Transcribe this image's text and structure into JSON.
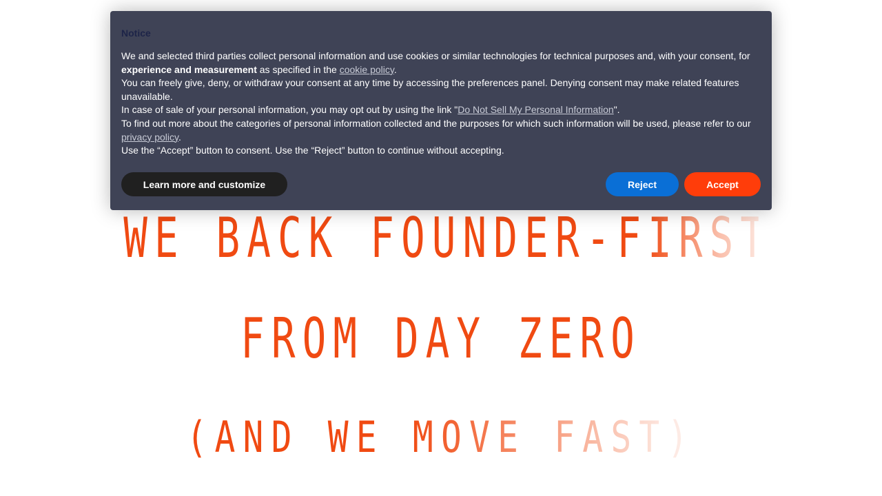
{
  "hero": {
    "line1": "WE BACK FOUNDER-FIRST",
    "line2": "FROM DAY ZERO",
    "line3": "(AND WE MOVE FAST)"
  },
  "cookie_banner": {
    "title": "Notice",
    "p1_text_a": "We and selected third parties collect personal information and use cookies or similar technologies for technical purposes and, with your consent, for ",
    "p1_bold": "experience and measurement",
    "p1_text_b": " as specified in the ",
    "p1_link": "cookie policy",
    "p1_text_c": ".",
    "p2": "You can freely give, deny, or withdraw your consent at any time by accessing the preferences panel. Denying consent may make related features unavailable.",
    "p3_text_a": "In case of sale of your personal information, you may opt out by using the link \"",
    "p3_link": "Do Not Sell My Personal Information",
    "p3_text_b": "\".",
    "p4_text_a": "To find out more about the categories of personal information collected and the purposes for which such information will be used, please refer to our ",
    "p4_link": "privacy policy",
    "p4_text_b": ".",
    "p5": "Use the “Accept” button to consent. Use the “Reject” button to continue without accepting.",
    "buttons": {
      "customize": "Learn more and customize",
      "reject": "Reject",
      "accept": "Accept"
    }
  },
  "colors": {
    "accent": "#f04a12",
    "banner_bg": "#3f4356",
    "reject_bg": "#0a6fd6",
    "accept_bg": "#ff3d0a",
    "customize_bg": "#202020"
  }
}
